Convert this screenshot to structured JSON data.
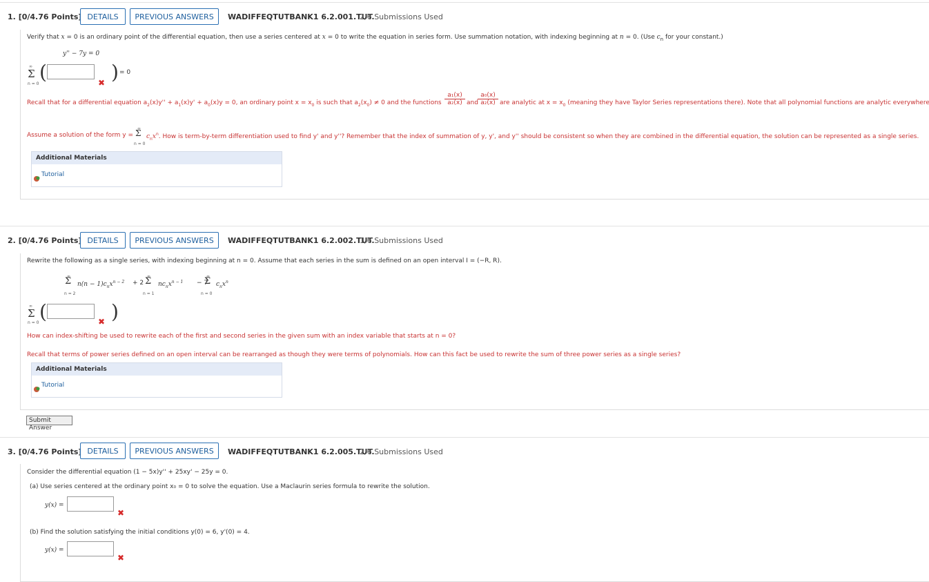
{
  "questions": [
    {
      "number": "1.",
      "points": "[0/4.76 Points]",
      "details_label": "DETAILS",
      "previous_label": "PREVIOUS ANSWERS",
      "code": "WADIFFEQTUTBANK1 6.2.001.TUT.",
      "submissions": "2/6 Submissions Used",
      "prompt_a": "Verify that ",
      "prompt_x0": "x",
      "prompt_b": " = 0 is an ordinary point of the differential equation, then use a series centered at ",
      "prompt_c": " = 0 to write the equation in series form. Use summation notation, with indexing beginning at ",
      "prompt_n": "n",
      "prompt_d": " = 0. (Use ",
      "prompt_cn": "c",
      "prompt_sub": "n",
      "prompt_e": " for your constant.)",
      "equation": "y'' − 7y = 0",
      "sigma_top": "∞",
      "sigma_bottom": "n = 0",
      "equals_zero": "= 0",
      "hint1_a": "Recall that for a differential equation a",
      "hint1_b": "(x)y'' + a",
      "hint1_c": "(x)y' + a",
      "hint1_d": "(x)y = 0, an ordinary point x = x",
      "hint1_e": " is such that a",
      "hint1_f": "(x",
      "hint1_g": ") ≠ 0 and the functions",
      "hint1_and": "and",
      "hint1_frac1_num": "a₁(x)",
      "hint1_frac1_den": "a₂(x)",
      "hint1_frac2_num": "a₀(x)",
      "hint1_frac2_den": "a₂(x)",
      "hint1_h": "are analytic at x = x",
      "hint1_i": " (meaning they have Taylor Series representations there). Note that all polynomial functions are analytic everywhere.",
      "hint2_a": "Assume a solution of the form y =",
      "hint2_b": "c",
      "hint2_c": "x",
      "hint2_d": ". How is term-by-term differentiation used to find y' and y''? Remember that the index of summation of y, y', and y'' should be consistent so when they are combined in the differential equation, the solution can be represented as a single series.",
      "additional_materials": "Additional Materials",
      "tutorial": "Tutorial"
    },
    {
      "number": "2.",
      "points": "[0/4.76 Points]",
      "details_label": "DETAILS",
      "previous_label": "PREVIOUS ANSWERS",
      "code": "WADIFFEQTUTBANK1 6.2.002.TUT.",
      "submissions": "1/6 Submissions Used",
      "prompt": "Rewrite the following as a single series, with indexing beginning at n = 0. Assume that each series in the sum is defined on an open interval I = (−R, R).",
      "series_term1": "n(n − 1)c",
      "series_term1_exp": "n − 2",
      "series_plus": "+ 2",
      "series_term2": "nc",
      "series_term2_exp": "n − 1",
      "series_minus": "− 7",
      "series_term3": "c",
      "series_sub": "n",
      "series_x": "x",
      "series_exp3": "n",
      "bottom1": "n = 2",
      "bottom2": "n = 1",
      "bottom3": "n = 0",
      "hint1": "How can index-shifting be used to rewrite each of the first and second series in the given sum with an index variable that starts at n = 0?",
      "hint2": "Recall that terms of power series defined on an open interval can be rearranged as though they were terms of polynomials. How can this fact be used to rewrite the sum of three power series as a single series?",
      "additional_materials": "Additional Materials",
      "tutorial": "Tutorial",
      "submit_label": "Submit Answer"
    },
    {
      "number": "3.",
      "points": "[0/4.76 Points]",
      "details_label": "DETAILS",
      "previous_label": "PREVIOUS ANSWERS",
      "code": "WADIFFEQTUTBANK1 6.2.005.TUT.",
      "submissions": "2/6 Submissions Used",
      "prompt": "Consider the differential equation (1 − 5x)y'' + 25xy' − 25y = 0.",
      "part_a": "(a)   Use series centered at the ordinary point x₀ = 0 to solve the equation. Use a Maclaurin series formula to rewrite the solution.",
      "part_b": "(b)   Find the solution satisfying the initial conditions y(0) = 6, y'(0) = 4.",
      "yx_label": "y(x) ="
    }
  ],
  "colors": {
    "hint_red": "#c83232",
    "button_blue": "#1d5e9d",
    "x_mark": "#d62b2b"
  }
}
